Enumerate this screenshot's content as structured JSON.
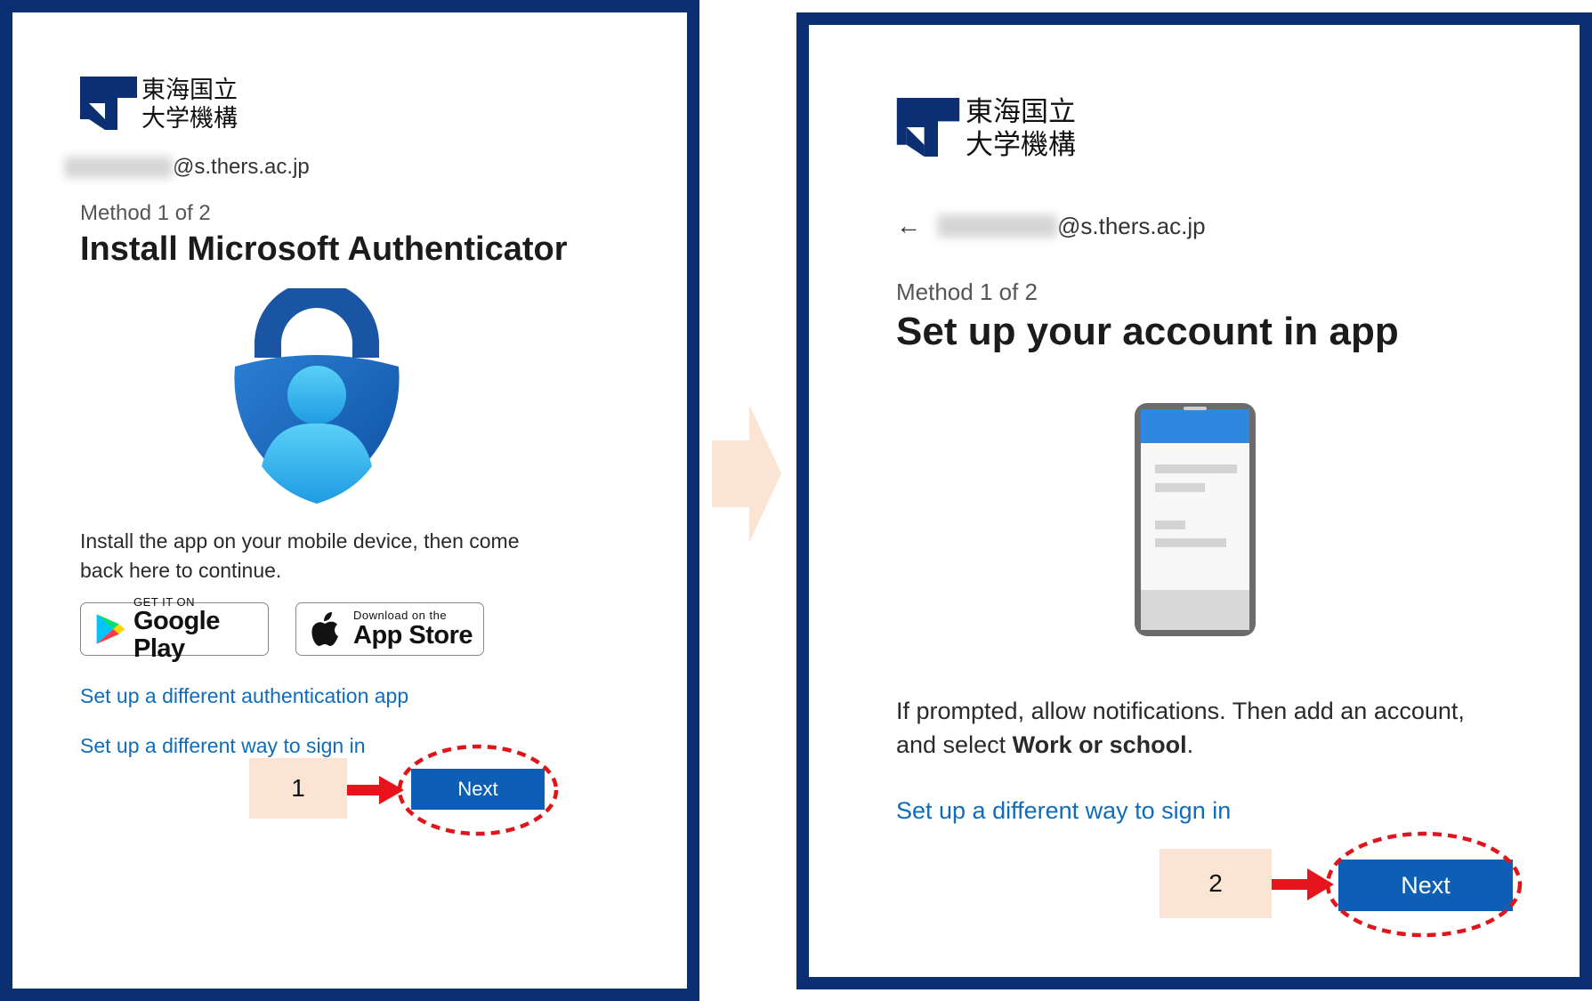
{
  "panel1": {
    "logo": {
      "line1": "東海国立",
      "line2": "大学機構"
    },
    "email_domain": "@s.thers.ac.jp",
    "method_label": "Method 1 of 2",
    "title": "Install Microsoft Authenticator",
    "instructions": "Install the app on your mobile device, then come back here to continue.",
    "google_play": {
      "small": "GET IT ON",
      "big": "Google Play"
    },
    "app_store": {
      "small": "Download on the",
      "big": "App Store"
    },
    "link_different_app": "Set up a different authentication app",
    "link_different_way": "Set up a different way to sign in",
    "step_number": "1",
    "next_label": "Next"
  },
  "panel2": {
    "logo": {
      "line1": "東海国立",
      "line2": "大学機構"
    },
    "back_arrow": "←",
    "email_domain": "@s.thers.ac.jp",
    "method_label": "Method 1 of 2",
    "title": "Set up your account in app",
    "instructions_pre": "If prompted, allow notifications. Then add an account, and select ",
    "instructions_bold": "Work or school",
    "instructions_post": ".",
    "link_different_way": "Set up a different way to sign in",
    "step_number": "2",
    "next_label": "Next"
  },
  "icons": [
    "logo-mark-icon",
    "authenticator-lock-icon",
    "google-play-icon",
    "apple-icon",
    "phone-illustration-icon",
    "arrow-right-icon"
  ],
  "colors": {
    "border": "#0c2f73",
    "link": "#0f6cbd",
    "button": "#0d5fb5",
    "highlight_ellipse": "#e0151b",
    "pointer_arrow": "#e8141b",
    "step_box": "#fbe4d4",
    "transition_arrow": "#fbe4d4"
  }
}
